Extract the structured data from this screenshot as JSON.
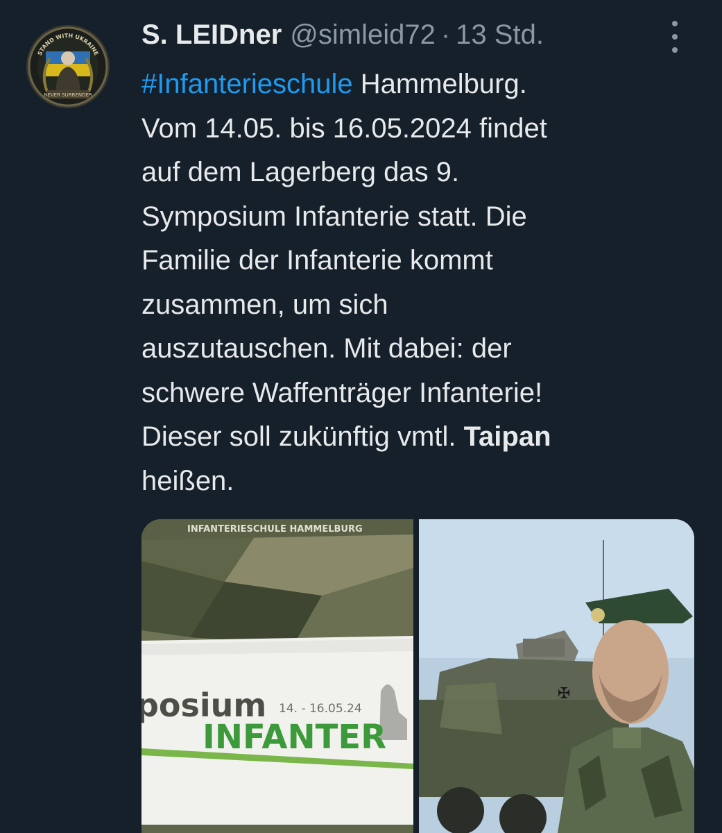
{
  "tweet": {
    "author_name": "S. LEIDner",
    "author_handle": "@simleid72",
    "separator": "·",
    "timestamp": "13 Std.",
    "hashtag": "#Infanterieschule",
    "text_lines": [
      " Hammelburg.",
      "Vom 14.05. bis 16.05.2024 findet",
      "auf dem Lagerberg das 9.",
      "Symposium Infanterie statt. Die",
      "Familie der Infanterie kommt",
      "zusammen, um sich",
      "auszutauschen. Mit dabei: der",
      "schwere Waffenträger Infanterie!",
      "Dieser soll zukünftig vmtl. "
    ],
    "bold_word": "Taipan",
    "last_line": "heißen."
  },
  "avatar": {
    "ring_text_top": "STAND WITH UKRAINE",
    "ring_text_bottom": "NEVER SURRENDER"
  },
  "media": {
    "left": {
      "header": "INFANTERIESCHULE HAMMELBURG",
      "word1": "posium",
      "dates": "14. - 16.05.24",
      "word2": "INFANTER"
    }
  },
  "icons": {
    "more": "more-vertical-icon"
  }
}
